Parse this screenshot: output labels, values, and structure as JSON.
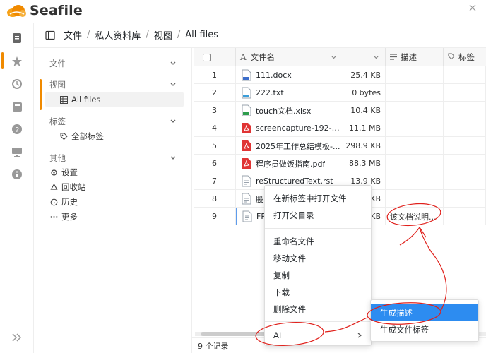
{
  "app": {
    "name": "Seafile"
  },
  "breadcrumb": {
    "items": [
      "文件",
      "私人资料库",
      "视图",
      "All files"
    ]
  },
  "nav": {
    "sections": [
      {
        "label": "文件"
      },
      {
        "label": "视图"
      },
      {
        "label": "标签"
      },
      {
        "label": "其他"
      }
    ],
    "view_item": "All files",
    "tag_item": "全部标签",
    "other_items": [
      "设置",
      "回收站",
      "历史",
      "更多"
    ]
  },
  "grid": {
    "headers": {
      "name": "文件名",
      "desc": "描述",
      "tag": "标签"
    },
    "rows": [
      {
        "idx": "1",
        "name": "111.docx",
        "size": "25.4 KB",
        "desc": "",
        "icon": "docx-icon"
      },
      {
        "idx": "2",
        "name": "222.txt",
        "size": "0 bytes",
        "desc": "",
        "icon": "txt-icon"
      },
      {
        "idx": "3",
        "name": "touch文档.xlsx",
        "size": "10.4 KB",
        "desc": "",
        "icon": "xlsx-icon"
      },
      {
        "idx": "4",
        "name": "screencapture-192-168...",
        "size": "11.1 MB",
        "desc": "",
        "icon": "pdf-icon"
      },
      {
        "idx": "5",
        "name": "2025年工作总结模板-...",
        "size": "298.9 KB",
        "desc": "",
        "icon": "pdf-icon"
      },
      {
        "idx": "6",
        "name": "程序员做饭指南.pdf",
        "size": "88.3 MB",
        "desc": "",
        "icon": "pdf-icon"
      },
      {
        "idx": "7",
        "name": "reStructuredText.rst",
        "size": "13.9 KB",
        "desc": "",
        "icon": "file-icon"
      },
      {
        "idx": "8",
        "name": "股",
        "size": "KB",
        "desc": "",
        "icon": "file-icon"
      },
      {
        "idx": "9",
        "name": "FP",
        "size": "KB",
        "desc": "该文档说明...",
        "icon": "file-icon"
      }
    ]
  },
  "footer": {
    "count": "9 个记录"
  },
  "context_menu": {
    "items": [
      "在新标签中打开文件",
      "打开父目录",
      "重命名文件",
      "移动文件",
      "复制",
      "下载",
      "删除文件",
      "AI"
    ]
  },
  "submenu": {
    "items": [
      "生成描述",
      "生成文件标签"
    ]
  },
  "colors": {
    "accent": "#f08a00",
    "highlight": "#2d8cf0",
    "annotation": "#e0201b"
  }
}
